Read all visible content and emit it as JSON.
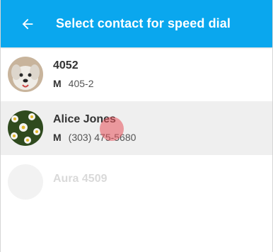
{
  "app": {
    "title": "Select contact for speed dial",
    "accent_color": "#0aa7ee",
    "back_icon": "arrow-left-icon"
  },
  "contacts": [
    {
      "name": "4052",
      "phone_type": "M",
      "phone": "405-2",
      "avatar": "dog-photo"
    },
    {
      "name": "Alice Jones",
      "phone_type": "M",
      "phone": "(303) 475-5680",
      "avatar": "daisy-flowers-photo",
      "pressed": true
    },
    {
      "name": "Aura 4509",
      "avatar": "partially-visible"
    }
  ]
}
